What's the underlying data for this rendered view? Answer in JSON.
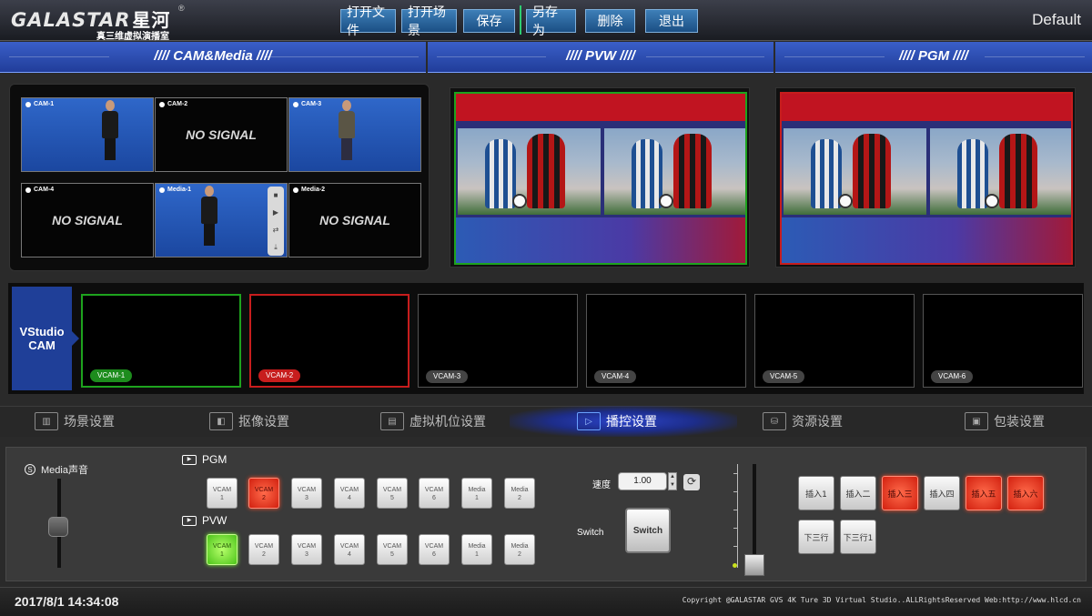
{
  "header": {
    "brand": "GALASTAR",
    "brand_cn": "星河",
    "brand_reg": "®",
    "slogan": "真三维虚拟演播室",
    "buttons": [
      "打开文件",
      "打开场景",
      "保存",
      "另存为",
      "删除",
      "退出"
    ],
    "profile": "Default"
  },
  "sections": {
    "cam_media": "//// CAM&Media ////",
    "pvw": "//// PVW ////",
    "pgm": "//// PGM ////"
  },
  "sources": [
    {
      "label": "CAM-1",
      "signal": true
    },
    {
      "label": "CAM-2",
      "signal": false,
      "text": "NO SIGNAL"
    },
    {
      "label": "CAM-3",
      "signal": true
    },
    {
      "label": "CAM-4",
      "signal": false,
      "text": "NO SIGNAL"
    },
    {
      "label": "Media-1",
      "signal": true
    },
    {
      "label": "Media-2",
      "signal": false,
      "text": "NO SIGNAL"
    }
  ],
  "vstudio": {
    "title": "VStudio CAM",
    "cams": [
      {
        "label": "VCAM-1",
        "state": "preview"
      },
      {
        "label": "VCAM-2",
        "state": "program"
      },
      {
        "label": "VCAM-3",
        "state": "idle"
      },
      {
        "label": "VCAM-4",
        "state": "idle"
      },
      {
        "label": "VCAM-5",
        "state": "idle"
      },
      {
        "label": "VCAM-6",
        "state": "idle"
      }
    ]
  },
  "tabs": [
    {
      "label": "场景设置",
      "icon": "scene-icon",
      "active": false
    },
    {
      "label": "抠像设置",
      "icon": "keying-icon",
      "active": false
    },
    {
      "label": "虚拟机位设置",
      "icon": "virtual-camera-icon",
      "active": false
    },
    {
      "label": "播控设置",
      "icon": "playout-icon",
      "active": true
    },
    {
      "label": "资源设置",
      "icon": "resource-icon",
      "active": false
    },
    {
      "label": "包装设置",
      "icon": "package-icon",
      "active": false
    }
  ],
  "control": {
    "media_audio": "Media声音",
    "pgm_label": "PGM",
    "pvw_label": "PVW",
    "sources": [
      "VCAM 1",
      "VCAM 2",
      "VCAM 3",
      "VCAM 4",
      "VCAM 5",
      "VCAM 6",
      "Media 1",
      "Media 2"
    ],
    "pgm_active": 1,
    "pvw_active": 0,
    "speed_label": "速度",
    "speed_value": "1.00",
    "switch_label": "Switch",
    "switch_button": "Switch",
    "inserts_row1": [
      "插入1",
      "插入二",
      "插入三",
      "插入四",
      "插入五",
      "插入六"
    ],
    "inserts_row1_active": [
      false,
      false,
      true,
      false,
      true,
      true
    ],
    "inserts_row2": [
      "下三行",
      "下三行1"
    ]
  },
  "status": {
    "datetime": "2017/8/1 14:34:08",
    "copyright": "Copyright @GALASTAR GVS 4K Ture 3D Virtual Studio..ALLRightsReserved Web:http://www.hlcd.cn"
  },
  "colors": {
    "accent_blue": "#213d9a",
    "pvw_green": "#1ea31e",
    "pgm_red": "#c71d1d"
  }
}
